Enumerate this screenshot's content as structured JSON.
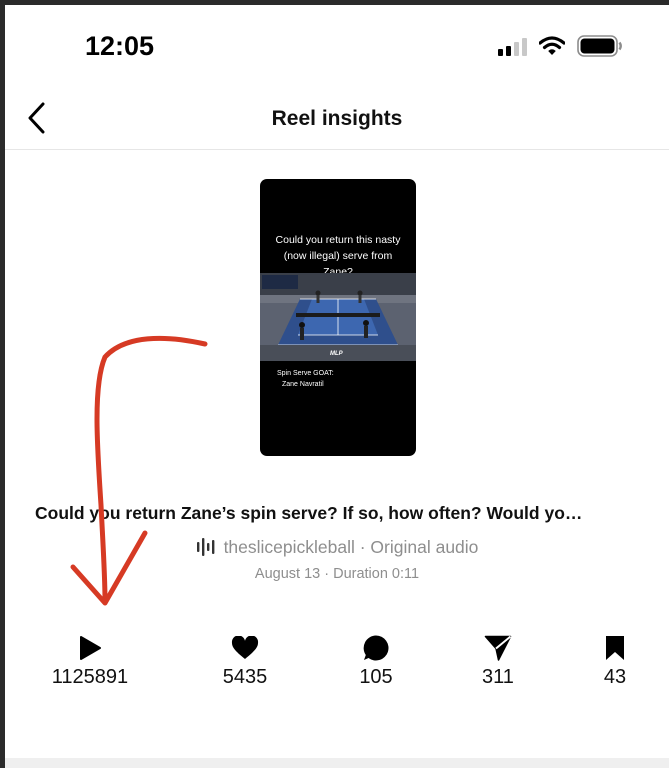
{
  "status_bar": {
    "time": "12:05"
  },
  "header": {
    "title": "Reel insights"
  },
  "reel": {
    "thumbnail_caption": "Could you return this nasty (now illegal) serve from Zane?",
    "thumbnail_subtitle_line1": "Spin Serve GOAT:",
    "thumbnail_subtitle_line2": "Zane Navratil",
    "thumbnail_logo": "MLP",
    "caption": "Could you return Zane’s spin serve? If so, how often? Would yo…",
    "audio": "theslicepickleball · Original audio",
    "meta": "August 13 · Duration 0:11"
  },
  "stats": [
    {
      "icon": "play-icon",
      "value": "1125891"
    },
    {
      "icon": "heart-icon",
      "value": "5435"
    },
    {
      "icon": "comment-icon",
      "value": "105"
    },
    {
      "icon": "share-icon",
      "value": "311"
    },
    {
      "icon": "bookmark-icon",
      "value": "43"
    }
  ],
  "colors": {
    "annotation": "#d63a24",
    "muted_text": "#8e8e8e",
    "background": "#ffffff"
  }
}
